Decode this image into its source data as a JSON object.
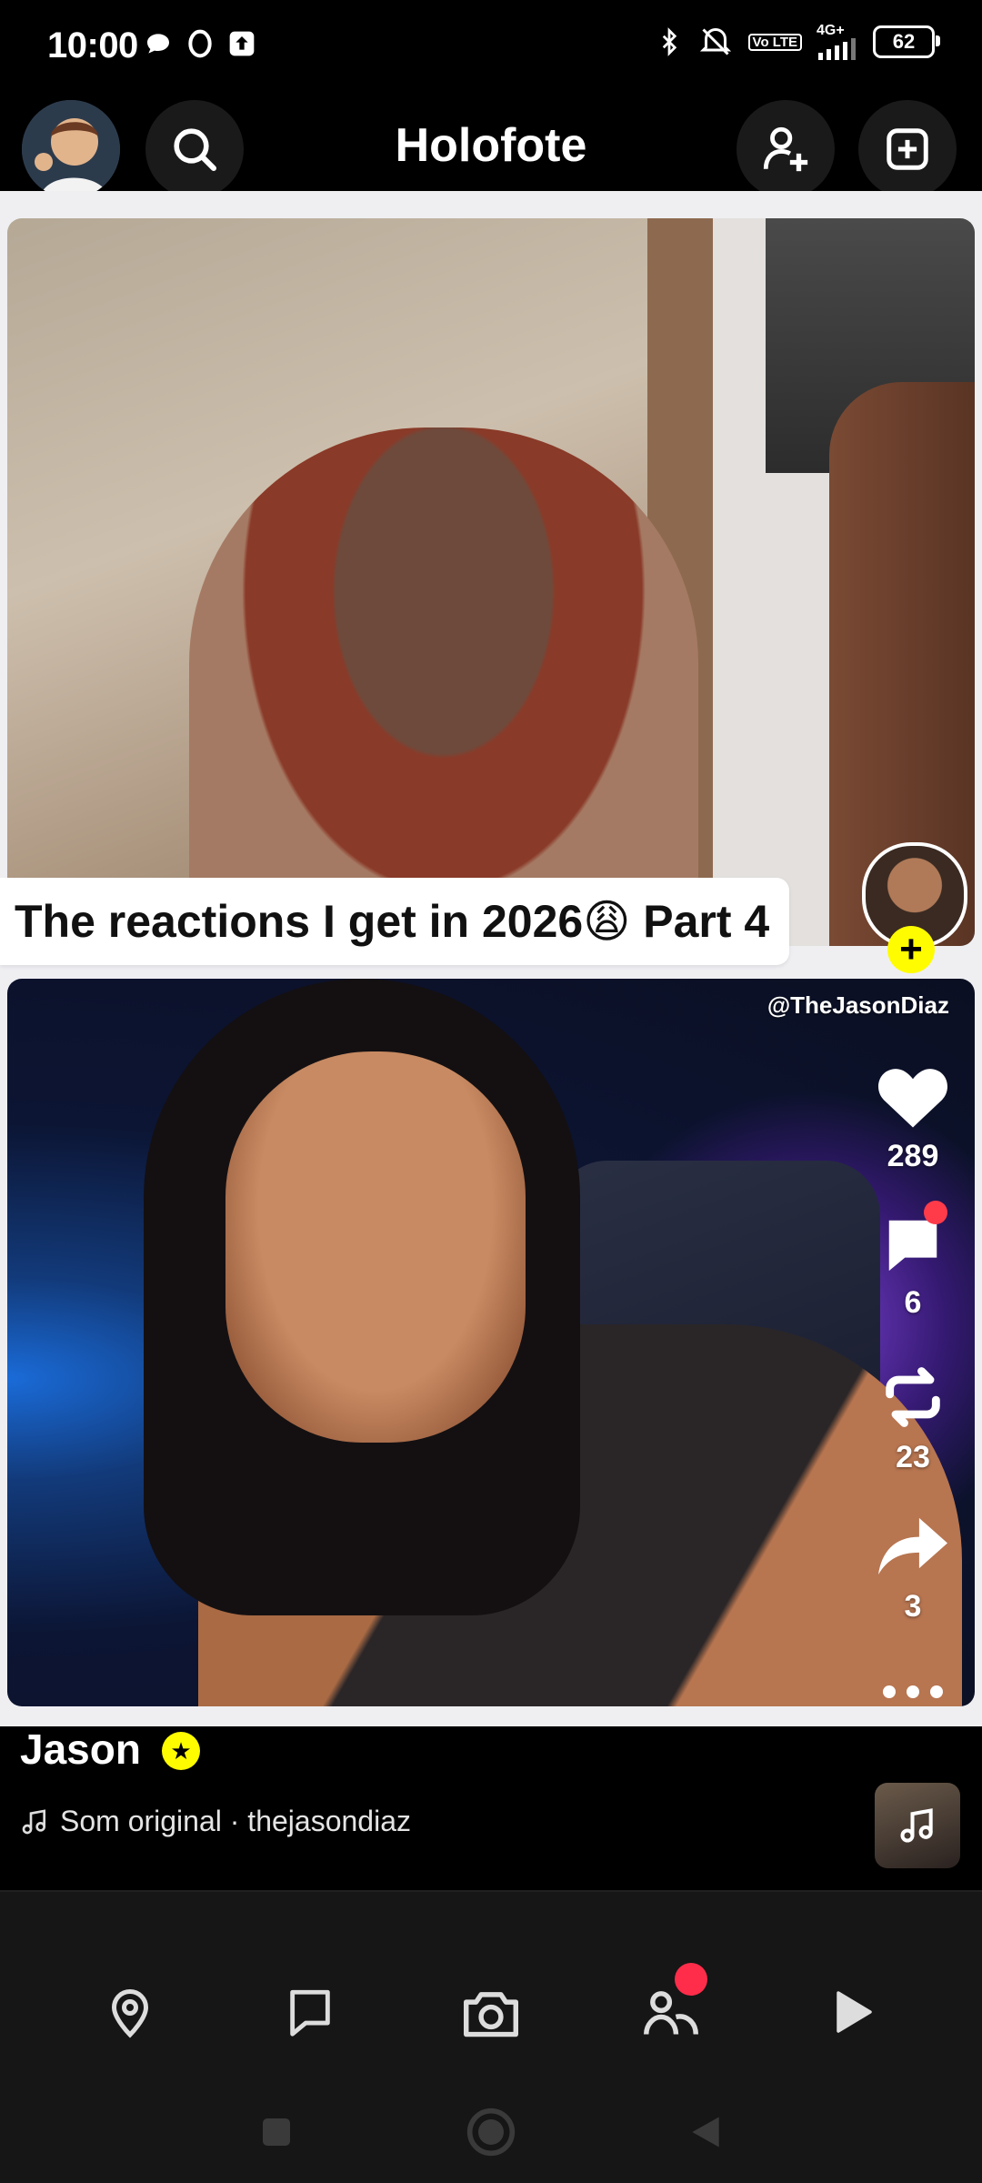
{
  "status_bar": {
    "time": "10:00",
    "network": "4G+",
    "lte": "Vo LTE",
    "battery": "62",
    "icons": [
      "chat-bubble-icon",
      "opera-icon",
      "upload-icon",
      "bluetooth-icon",
      "mute-icon",
      "signal-icon"
    ]
  },
  "header": {
    "title": "Holofote",
    "left_buttons": [
      "avatar",
      "search-icon"
    ],
    "right_buttons": [
      "add-friend-icon",
      "new-story-icon"
    ]
  },
  "top_card": {
    "caption": "The reactions I get in 2026😩 Part 4"
  },
  "main_card": {
    "watermark": "@TheJasonDiaz",
    "actions": {
      "likes": "289",
      "comments": "6",
      "remixes": "23",
      "shares": "3"
    }
  },
  "creator": {
    "name": "Jason",
    "sound": "Som original · thejasondiaz"
  },
  "bottom_nav": {
    "items": [
      "map-icon",
      "chat-icon",
      "camera-icon",
      "stories-icon",
      "spotlight-icon"
    ]
  },
  "colors": {
    "accent_yellow": "#fffc00",
    "notification_red": "#ff3b4a",
    "feed_bg": "#efeff2"
  }
}
